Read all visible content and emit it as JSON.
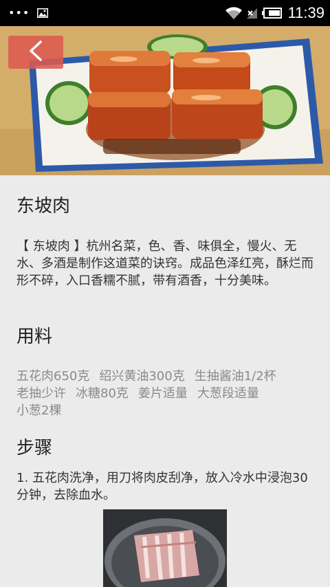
{
  "status_bar": {
    "dots": "•••",
    "time": "11:39",
    "icons": [
      "overflow-dots-icon",
      "gallery-icon",
      "wifi-icon",
      "no-signal-icon",
      "battery-icon"
    ]
  },
  "header": {
    "back_icon": "chevron-left-icon",
    "hero_image": "dongpo-pork-dish-photo"
  },
  "recipe": {
    "title": "东坡肉",
    "description": "【 东坡肉 】杭州名菜，色、香、味俱全，慢火、无水、多酒是制作这道菜的诀窍。成品色泽红亮，酥烂而形不碎，入口香糯不腻，带有酒香，十分美味。",
    "ingredients_title": "用料",
    "ingredients": [
      "五花肉650克",
      "绍兴黄油300克",
      "生抽酱油1/2杯",
      "老抽少许",
      "冰糖80克",
      "姜片适量",
      "大葱段适量",
      "小葱2棵"
    ],
    "steps_title": "步骤",
    "steps": [
      {
        "text": "1. 五花肉洗净，用刀将肉皮刮净，放入冷水中浸泡30分钟，去除血水。",
        "image": "raw-pork-belly-in-pot-photo"
      }
    ]
  },
  "colors": {
    "status_bar_bg": "#000000",
    "page_bg": "#ebebeb",
    "back_button_bg": "#dc5a50",
    "ingredient_text": "#8a8a8a"
  }
}
